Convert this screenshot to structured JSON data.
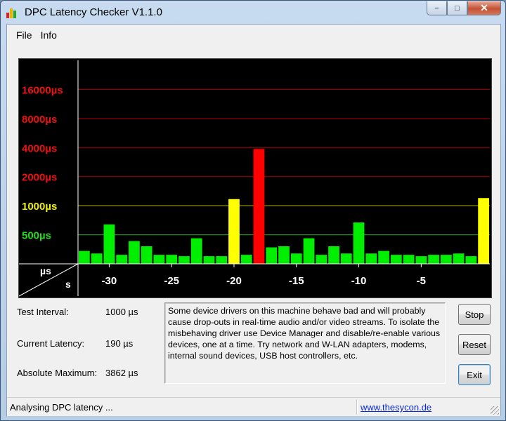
{
  "window": {
    "title": "DPC Latency Checker V1.1.0",
    "controls": {
      "minimize": "−",
      "maximize": "□",
      "close": "✕"
    }
  },
  "menu": [
    {
      "label": "File"
    },
    {
      "label": "Info"
    }
  ],
  "chart_data": {
    "type": "bar",
    "y_unit_label": "µs",
    "x_unit_label": "s",
    "y_scale": "log2",
    "ylim": [
      250,
      32000
    ],
    "y_ticks": [
      {
        "value": 500,
        "label": "500µs",
        "color": "#22dd22"
      },
      {
        "value": 1000,
        "label": "1000µs",
        "color": "#eeee00"
      },
      {
        "value": 2000,
        "label": "2000µs",
        "color": "#ee1111"
      },
      {
        "value": 4000,
        "label": "4000µs",
        "color": "#ee1111"
      },
      {
        "value": 8000,
        "label": "8000µs",
        "color": "#ee1111"
      },
      {
        "value": 16000,
        "label": "16000µs",
        "color": "#ee1111"
      }
    ],
    "x_ticks": [
      {
        "value": -30,
        "label": "-30"
      },
      {
        "value": -25,
        "label": "-25"
      },
      {
        "value": -20,
        "label": "-20"
      },
      {
        "value": -15,
        "label": "-15"
      },
      {
        "value": -10,
        "label": "-10"
      },
      {
        "value": -5,
        "label": "-5"
      }
    ],
    "xlim": [
      -32.5,
      0.5
    ],
    "x": [
      -32,
      -31,
      -30,
      -29,
      -28,
      -27,
      -26,
      -25,
      -24,
      -23,
      -22,
      -21,
      -20,
      -19,
      -18,
      -17,
      -16,
      -15,
      -14,
      -13,
      -12,
      -11,
      -10,
      -9,
      -8,
      -7,
      -6,
      -5,
      -4,
      -3,
      -2,
      -1,
      0
    ],
    "values": [
      340,
      320,
      640,
      310,
      430,
      380,
      310,
      310,
      300,
      460,
      300,
      300,
      1170,
      310,
      3862,
      370,
      380,
      320,
      460,
      310,
      380,
      320,
      670,
      320,
      340,
      310,
      310,
      300,
      310,
      310,
      320,
      300,
      1200
    ],
    "colors": {
      "ok": "#00ee00",
      "warn": "#ffff00",
      "bad": "#ff0000",
      "grid_green": "#22aa22",
      "grid_yellow": "#bbbb00",
      "grid_red": "#aa0000"
    }
  },
  "stats": {
    "interval_label": "Test Interval:",
    "interval_value": "1000 µs",
    "current_label": "Current Latency:",
    "current_value": "190 µs",
    "max_label": "Absolute Maximum:",
    "max_value": "3862 µs"
  },
  "message": "Some device drivers on this machine behave bad and will probably cause drop-outs in real-time audio and/or video streams. To isolate the misbehaving driver use Device Manager and disable/re-enable various devices, one at a time. Try network and W-LAN adapters, modems, internal sound devices, USB host controllers, etc.",
  "buttons": {
    "stop": "Stop",
    "reset": "Reset",
    "exit": "Exit"
  },
  "status": {
    "text": "Analysing DPC latency ...",
    "link": "www.thesycon.de"
  }
}
